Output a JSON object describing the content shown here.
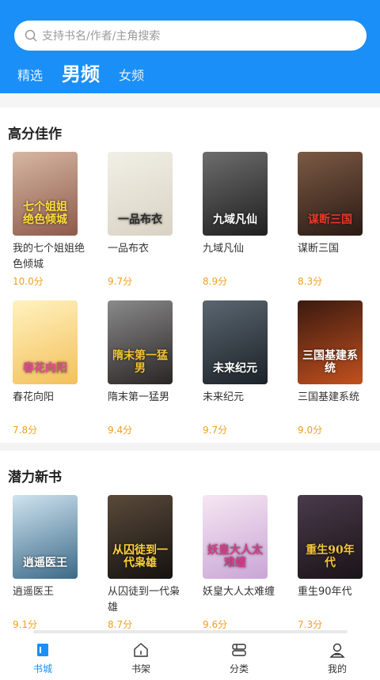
{
  "search": {
    "placeholder": "支持书名/作者/主角搜索"
  },
  "tabs": [
    {
      "label": "精选",
      "active": false
    },
    {
      "label": "男频",
      "active": true
    },
    {
      "label": "女频",
      "active": false
    }
  ],
  "sections": [
    {
      "title": "高分佳作",
      "books": [
        {
          "title": "我的七个姐姐绝色倾城",
          "score": "10.0分",
          "cover_text": "七个姐姐 绝色倾城",
          "cover_colors": [
            "#d6b7a3",
            "#8e5a4a"
          ],
          "text_color": "#ffdf3a"
        },
        {
          "title": "一品布衣",
          "score": "9.7分",
          "cover_text": "一品布衣",
          "cover_colors": [
            "#f2efe6",
            "#d8d3c4"
          ],
          "text_color": "#2b2b2b"
        },
        {
          "title": "九域凡仙",
          "score": "8.9分",
          "cover_text": "九域凡仙",
          "cover_colors": [
            "#6d6d6d",
            "#1f1f1f"
          ],
          "text_color": "#ffffff"
        },
        {
          "title": "谋断三国",
          "score": "8.3分",
          "cover_text": "谋断三国",
          "cover_colors": [
            "#7c5a44",
            "#2a1a14"
          ],
          "text_color": "#e23a2a"
        },
        {
          "title": "春花向阳",
          "score": "7.8分",
          "cover_text": "春花向阳",
          "cover_colors": [
            "#fff2c0",
            "#f3c05a"
          ],
          "text_color": "#e04a8a"
        },
        {
          "title": "隋末第一猛男",
          "score": "9.4分",
          "cover_text": "隋末第一猛男",
          "cover_colors": [
            "#8a8a8a",
            "#2a2525"
          ],
          "text_color": "#f2c232"
        },
        {
          "title": "未来纪元",
          "score": "9.7分",
          "cover_text": "未来纪元",
          "cover_colors": [
            "#5a6670",
            "#1c2228"
          ],
          "text_color": "#ffffff"
        },
        {
          "title": "三国基建系统",
          "score": "9.0分",
          "cover_text": "三国基建系统",
          "cover_colors": [
            "#3a1a10",
            "#c2501e"
          ],
          "text_color": "#ffffff"
        }
      ]
    },
    {
      "title": "潜力新书",
      "books": [
        {
          "title": "逍遥医王",
          "score": "9.1分",
          "cover_text": "逍遥医王",
          "cover_colors": [
            "#cfe4f0",
            "#3c6a88"
          ],
          "text_color": "#ffffff"
        },
        {
          "title": "从囚徒到一代枭雄",
          "score": "8.7分",
          "cover_text": "从囚徒到一代枭雄",
          "cover_colors": [
            "#5a4a3a",
            "#151210"
          ],
          "text_color": "#ffd23a"
        },
        {
          "title": "妖皇大人太难缠",
          "score": "9.6分",
          "cover_text": "妖皇大人太难缠",
          "cover_colors": [
            "#f6e6f2",
            "#c9a6d6"
          ],
          "text_color": "#d63a8a"
        },
        {
          "title": "重生90年代",
          "score": "7.3分",
          "cover_text": "重生90年代",
          "cover_colors": [
            "#4a3a4a",
            "#1a1418"
          ],
          "text_color": "#f5c43a"
        }
      ]
    }
  ],
  "bottom_nav": [
    {
      "label": "书城",
      "icon": "bookstore-icon",
      "active": true
    },
    {
      "label": "书架",
      "icon": "bookshelf-icon",
      "active": false
    },
    {
      "label": "分类",
      "icon": "category-icon",
      "active": false
    },
    {
      "label": "我的",
      "icon": "profile-icon",
      "active": false
    }
  ],
  "colors": {
    "primary": "#1a8ff7",
    "score": "#f0a020",
    "nav_active": "#1a8ff7"
  }
}
